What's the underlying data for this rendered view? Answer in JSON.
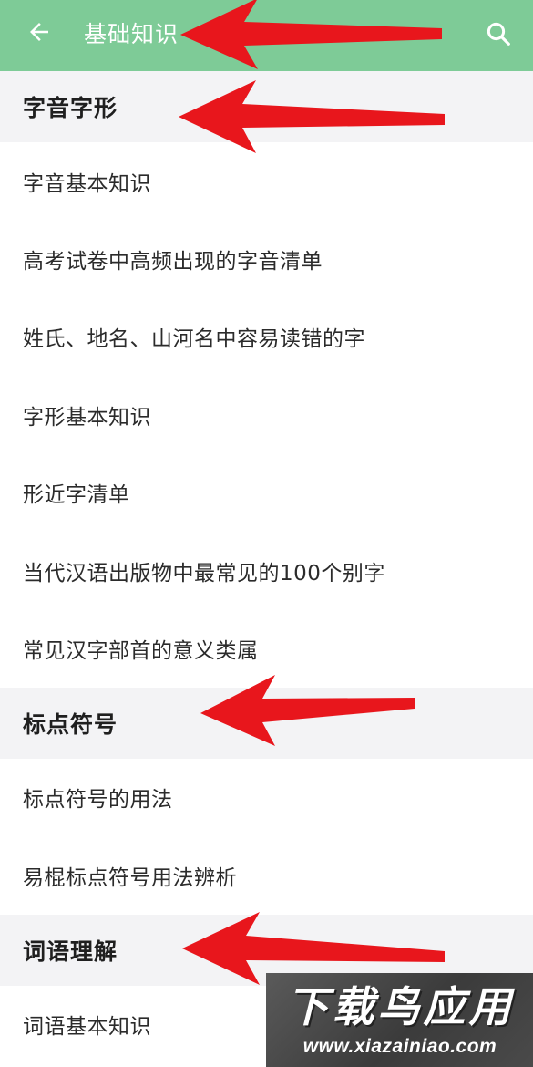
{
  "appbar": {
    "title": "基础知识",
    "back_icon": "arrow-left-icon",
    "search_icon": "search-icon",
    "background": "#7ecb97"
  },
  "sections": [
    {
      "title": "字音字形",
      "items": [
        "字音基本知识",
        "高考试卷中高频出现的字音清单",
        "姓氏、地名、山河名中容易读错的字",
        "字形基本知识",
        "形近字清单",
        "当代汉语出版物中最常见的100个别字",
        "常见汉字部首的意义类属"
      ]
    },
    {
      "title": "标点符号",
      "items": [
        "标点符号的用法",
        "易棍标点符号用法辨析"
      ]
    },
    {
      "title": "词语理解",
      "items": [
        "词语基本知识"
      ]
    }
  ],
  "watermark": {
    "text": "下载鸟应用",
    "url": "www.xiazainiao.com"
  },
  "annotation_color": "#e8161c"
}
